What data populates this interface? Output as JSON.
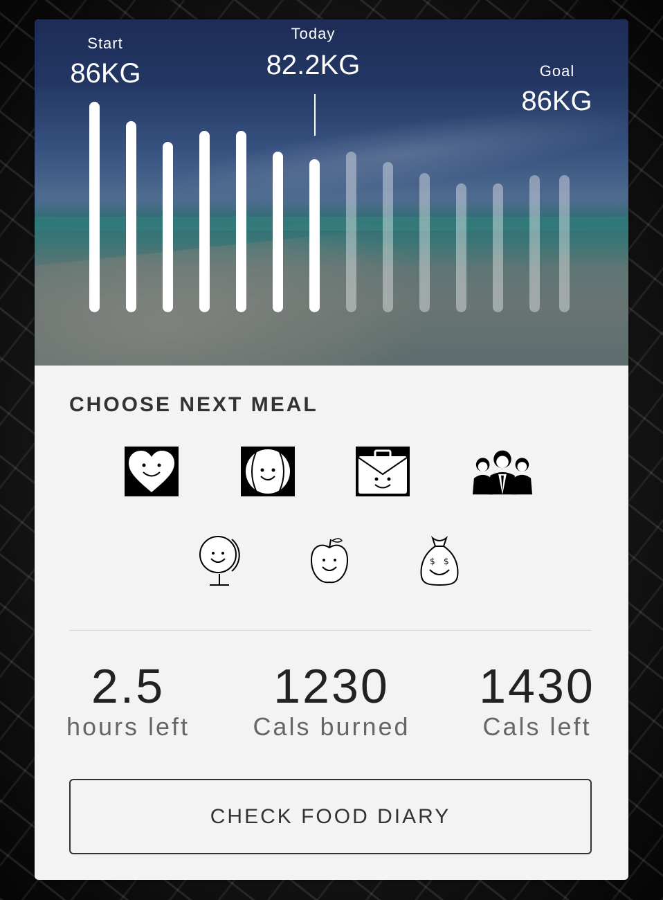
{
  "weight": {
    "start": {
      "label": "Start",
      "value": "86KG"
    },
    "today": {
      "label": "Today",
      "value": "82.2KG"
    },
    "goal": {
      "label": "Goal",
      "value": "86KG"
    },
    "bars_past": 7,
    "bars_future": 7
  },
  "meal_section": {
    "title": "CHOOSE NEXT MEAL",
    "icons": [
      "heart-face-icon",
      "tennis-ball-face-icon",
      "briefcase-face-icon",
      "group-people-icon",
      "globe-face-icon",
      "apple-face-icon",
      "money-bag-face-icon"
    ]
  },
  "stats": {
    "hours": {
      "value": "2.5",
      "label": "hours left"
    },
    "burned": {
      "value": "1230",
      "label": "Cals burned"
    },
    "left": {
      "value": "1430",
      "label": "Cals left"
    }
  },
  "button": {
    "label": "CHECK FOOD DIARY"
  }
}
